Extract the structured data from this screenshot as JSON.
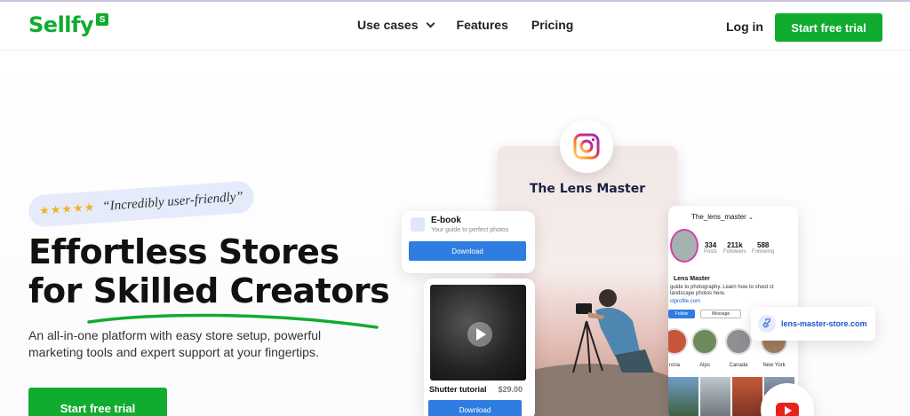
{
  "brand": {
    "name": "Sellfy",
    "badge": "S",
    "color": "#10ac2f"
  },
  "nav": {
    "items": [
      {
        "label": "Use cases",
        "has_dropdown": true
      },
      {
        "label": "Features"
      },
      {
        "label": "Pricing"
      }
    ],
    "login": "Log in",
    "cta": "Start free trial"
  },
  "hero": {
    "rating_stars": "★★★★★",
    "quote": "“Incredibly user-friendly”",
    "headline_line1": "Effortless Stores",
    "headline_line2": "for Skilled Creators",
    "subtext": "An all-in-one platform with easy store setup, powerful marketing tools and expert support at your fingertips.",
    "cta": "Start free trial"
  },
  "collage": {
    "lens_card_title": "The Lens Master",
    "ebook": {
      "title": "E-book",
      "subtitle": "Your guide to perfect photos",
      "button": "Download"
    },
    "video": {
      "title": "Shutter tutorial",
      "price": "$29.00",
      "button": "Download"
    },
    "profile": {
      "handle": "The_lens_master",
      "stats": [
        {
          "num": "334",
          "label": "Posts"
        },
        {
          "num": "211k",
          "label": "Followers"
        },
        {
          "num": "588",
          "label": "Following"
        }
      ],
      "name": "Lens Master",
      "bio": "guide to photography. Learn how to shoot ct landscape photos here.",
      "link": "ctprofile.com",
      "follow_button": "Follow",
      "message_button": "Message",
      "highlights": [
        {
          "label": "rona"
        },
        {
          "label": "Alps"
        },
        {
          "label": "Canada"
        },
        {
          "label": "New York"
        }
      ]
    },
    "store_link": "lens-master-store.com"
  }
}
